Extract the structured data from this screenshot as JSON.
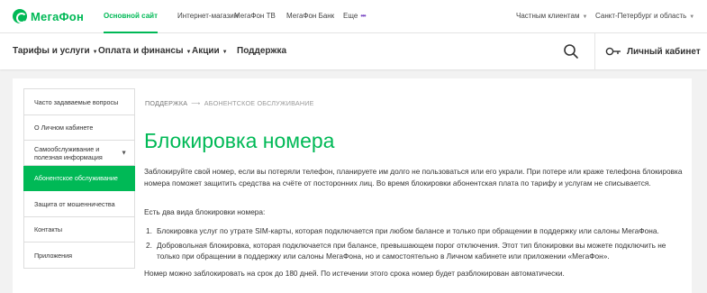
{
  "brand": {
    "logo_text": "МегаФон",
    "accent": "#00b956",
    "more_dots_color": "#7b4ac4"
  },
  "topbar": {
    "links": [
      "Основной сайт",
      "Интернет-магазин",
      "МегаФон ТВ",
      "МегаФон Банк",
      "Еще"
    ],
    "more_dots": "•••",
    "segment": "Частным клиентам",
    "region": "Санкт-Петербург и область"
  },
  "navbar": {
    "items": [
      "Тарифы и услуги",
      "Оплата и финансы",
      "Акции",
      "Поддержка"
    ],
    "cabinet_label": "Личный кабинет"
  },
  "sidebar": {
    "items": [
      "Часто задаваемые вопросы",
      "О Личном кабинете",
      "Самообслуживание и полезная информация",
      "Абонентское обслуживание",
      "Защита от мошенничества",
      "Контакты",
      "Приложения"
    ]
  },
  "breadcrumb": {
    "parent": "ПОДДЕРЖКА",
    "current": "АБОНЕНТСКОЕ ОБСЛУЖИВАНИЕ"
  },
  "article": {
    "title": "Блокировка номера",
    "intro": "Заблокируйте свой номер, если вы потеряли телефон, планируете им долго не пользоваться или его украли. При потере или краже телефона блокировка номера поможет защитить средства на счёте от посторонних лиц. Во время блокировки абонентская плата по тарифу и услугам не списывается.",
    "types_heading": "Есть два вида блокировки номера:",
    "types": [
      "Блокировка услуг по утрате SIM-карты, которая подключается при любом балансе и только при обращении в поддержку или салоны МегаФона.",
      "Добровольная блокировка, которая подключается при балансе, превышающем порог отключения. Этот тип блокировки вы можете подключить не только при обращении в поддержку или салоны МегаФона, но и самостоятельно в Личном кабинете или приложении «МегаФон»."
    ],
    "term": "Номер можно заблокировать на срок до 180 дней. По истечении этого срока номер будет разблокирован автоматически."
  }
}
